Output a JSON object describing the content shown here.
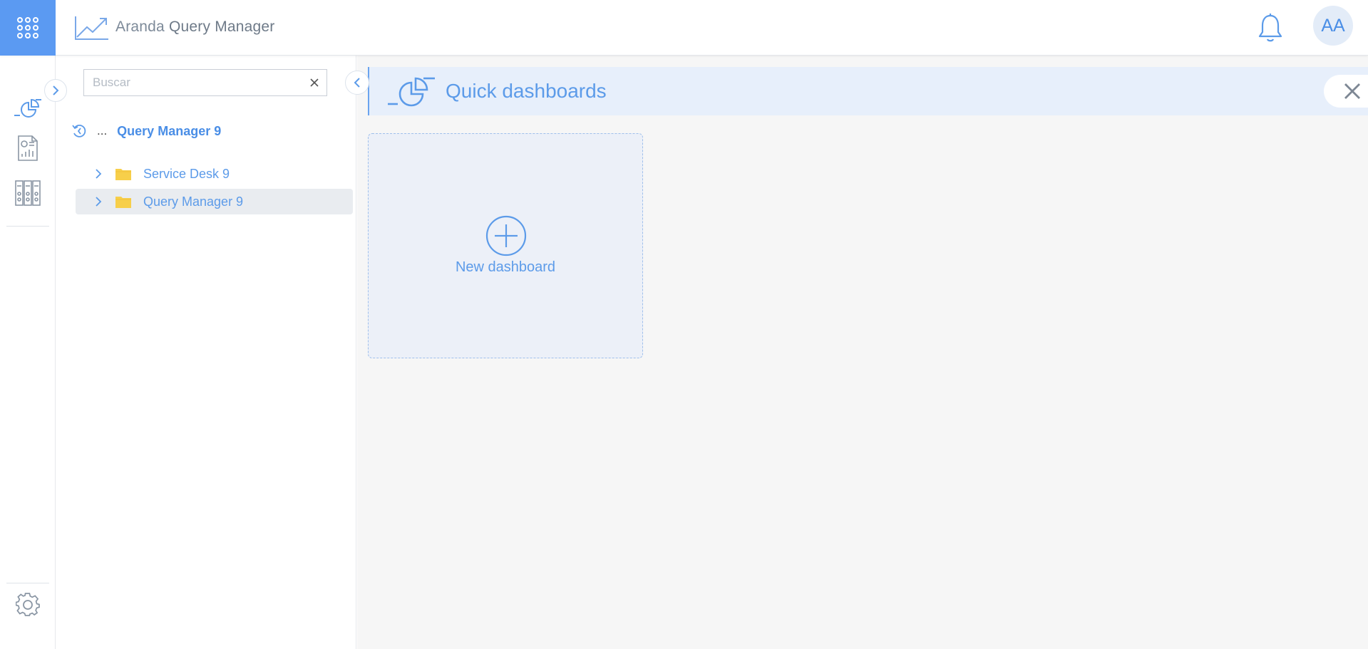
{
  "app": {
    "brand_prefix": "Aranda",
    "brand_name": "Query Manager",
    "avatar_initials": "AA",
    "apps_icon": "apps-grid-icon",
    "notification_icon": "bell-icon"
  },
  "rail": {
    "items": [
      {
        "icon": "quick-dashboards-icon",
        "label": "Quick dashboards"
      },
      {
        "icon": "report-icon",
        "label": "Reports"
      },
      {
        "icon": "data-sources-icon",
        "label": "Data sources"
      }
    ],
    "settings_icon": "gear-icon"
  },
  "tree": {
    "search": {
      "placeholder": "Buscar",
      "value": ""
    },
    "breadcrumb": {
      "ellipsis": "...",
      "current": "Query Manager 9"
    },
    "items": [
      {
        "label": "Service Desk 9",
        "selected": false
      },
      {
        "label": "Query Manager 9",
        "selected": true
      }
    ]
  },
  "main": {
    "title": "Quick dashboards",
    "new_dashboard_label": "New dashboard"
  },
  "colors": {
    "accent": "#5b9af2",
    "text_accent": "#5c9be9",
    "folder": "#f7cf4a",
    "selected_row": "#e9ecf0",
    "header_band": "#e7effb"
  }
}
